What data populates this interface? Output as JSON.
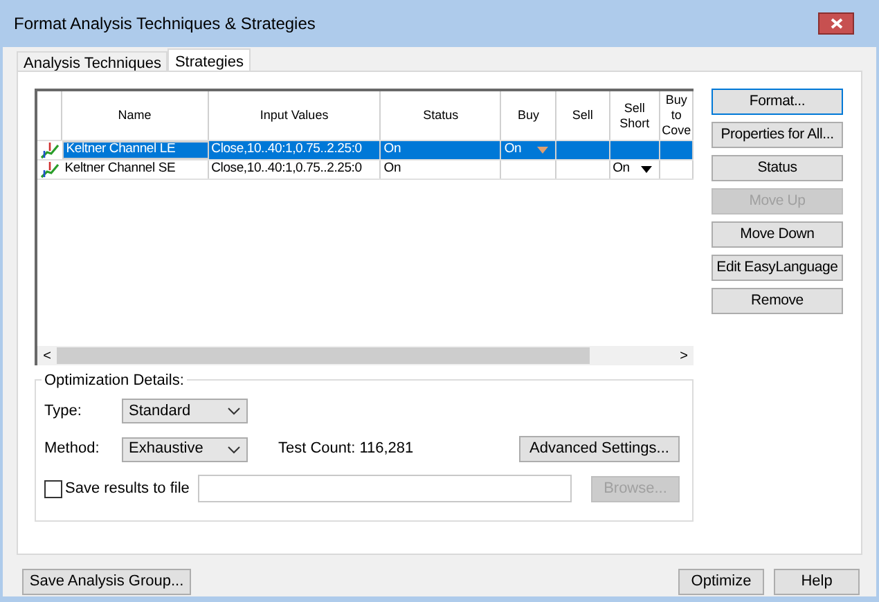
{
  "window": {
    "title": "Format Analysis Techniques & Strategies"
  },
  "tabs": [
    {
      "label": "Analysis Techniques",
      "selected": false
    },
    {
      "label": "Strategies",
      "selected": true
    }
  ],
  "table": {
    "columns": [
      "Name",
      "Input Values",
      "Status",
      "Buy",
      "Sell",
      "Sell Short",
      "Buy to Cove"
    ],
    "rows": [
      {
        "selected": true,
        "cells": [
          {
            "text": "Keltner Channel LE",
            "dropdown": false
          },
          {
            "text": "Close,10..40:1,0.75..2.25:0",
            "dropdown": false
          },
          {
            "text": "On",
            "dropdown": false
          },
          {
            "text": "On",
            "dropdown": true
          },
          {
            "text": "",
            "dropdown": false
          },
          {
            "text": "",
            "dropdown": false
          },
          {
            "text": "",
            "dropdown": false
          }
        ]
      },
      {
        "selected": false,
        "cells": [
          {
            "text": "Keltner Channel SE",
            "dropdown": false
          },
          {
            "text": "Close,10..40:1,0.75..2.25:0",
            "dropdown": false
          },
          {
            "text": "On",
            "dropdown": false
          },
          {
            "text": "",
            "dropdown": false
          },
          {
            "text": "",
            "dropdown": false
          },
          {
            "text": "On",
            "dropdown": true
          },
          {
            "text": "",
            "dropdown": false
          }
        ]
      }
    ],
    "scroll_left": "<",
    "scroll_right": ">"
  },
  "side_buttons": [
    {
      "label": "Format...",
      "disabled": false,
      "focused": true
    },
    {
      "label": "Properties for All...",
      "disabled": false,
      "focused": false
    },
    {
      "label": "Status",
      "disabled": false,
      "focused": false
    },
    {
      "label": "Move Up",
      "disabled": true,
      "focused": false
    },
    {
      "label": "Move Down",
      "disabled": false,
      "focused": false
    },
    {
      "label": "Edit EasyLanguage",
      "disabled": false,
      "focused": false
    },
    {
      "label": "Remove",
      "disabled": false,
      "focused": false
    }
  ],
  "optimization": {
    "title": "Optimization Details:",
    "type_label": "Type:",
    "type_value": "Standard",
    "method_label": "Method:",
    "method_value": "Exhaustive",
    "test_count": "Test Count: 116,281",
    "advanced_button": "Advanced Settings...",
    "save_label": "Save results to file",
    "save_checked": false,
    "browse_button": "Browse...",
    "browse_disabled": true
  },
  "footer": {
    "save_group": "Save Analysis Group...",
    "optimize": "Optimize",
    "help": "Help"
  }
}
